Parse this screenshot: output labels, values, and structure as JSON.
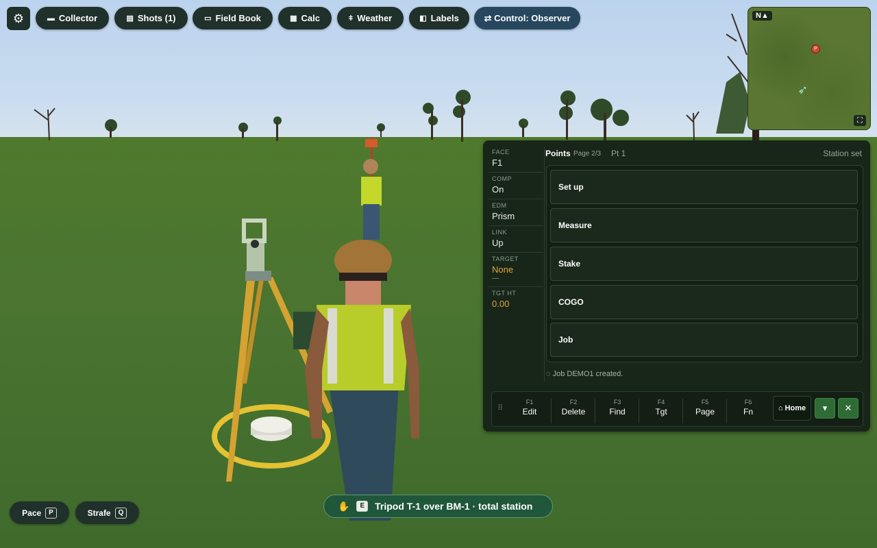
{
  "toolbar": {
    "settings_icon": "gear-icon",
    "buttons": [
      {
        "label": "Collector",
        "icon": "collector-icon"
      },
      {
        "label": "Shots (1)",
        "icon": "clipboard-icon"
      },
      {
        "label": "Field Book",
        "icon": "book-icon"
      },
      {
        "label": "Calc",
        "icon": "calculator-icon"
      },
      {
        "label": "Weather",
        "icon": "thermometer-icon"
      },
      {
        "label": "Labels",
        "icon": "tag-icon"
      }
    ],
    "control": {
      "label": "⇄ Control: Observer"
    }
  },
  "minimap": {
    "north_label": "N▲",
    "marker_label": "P"
  },
  "panel": {
    "status": [
      {
        "key": "FACE",
        "value": "F1"
      },
      {
        "key": "COMP",
        "value": "On"
      },
      {
        "key": "EDM",
        "value": "Prism"
      },
      {
        "key": "LINK",
        "value": "Up"
      },
      {
        "key": "TARGET",
        "value": "None",
        "sub": "—"
      },
      {
        "key": "TGT HT",
        "value": "0.00"
      }
    ],
    "title": "Points",
    "page": "Page 2/3",
    "point": "Pt 1",
    "station_status": "Station set",
    "menu": [
      {
        "label": "Set up"
      },
      {
        "label": "Measure"
      },
      {
        "label": "Stake"
      },
      {
        "label": "COGO"
      },
      {
        "label": "Job"
      }
    ],
    "message": "◌ Job DEMO1 created.",
    "fkeys": [
      {
        "key": "F1",
        "label": "Edit"
      },
      {
        "key": "F2",
        "label": "Delete"
      },
      {
        "key": "F3",
        "label": "Find"
      },
      {
        "key": "F4",
        "label": "Tgt"
      },
      {
        "key": "F5",
        "label": "Page"
      },
      {
        "key": "F6",
        "label": "Fn"
      }
    ],
    "home_label": "⌂ Home",
    "dropdown_glyph": "▾",
    "close_glyph": "✕"
  },
  "controls": {
    "pace": {
      "label": "Pace",
      "key": "P"
    },
    "strafe": {
      "label": "Strafe",
      "key": "Q"
    }
  },
  "prompt": {
    "icon": "✋",
    "key": "E",
    "text": "Tripod T-1 over BM-1 · total station"
  },
  "colors": {
    "hud_dark": "#20302a",
    "accent_blue": "#26475e",
    "panel_bg": "#182519",
    "warn": "#e0a63a",
    "prompt_green": "#20573a"
  }
}
